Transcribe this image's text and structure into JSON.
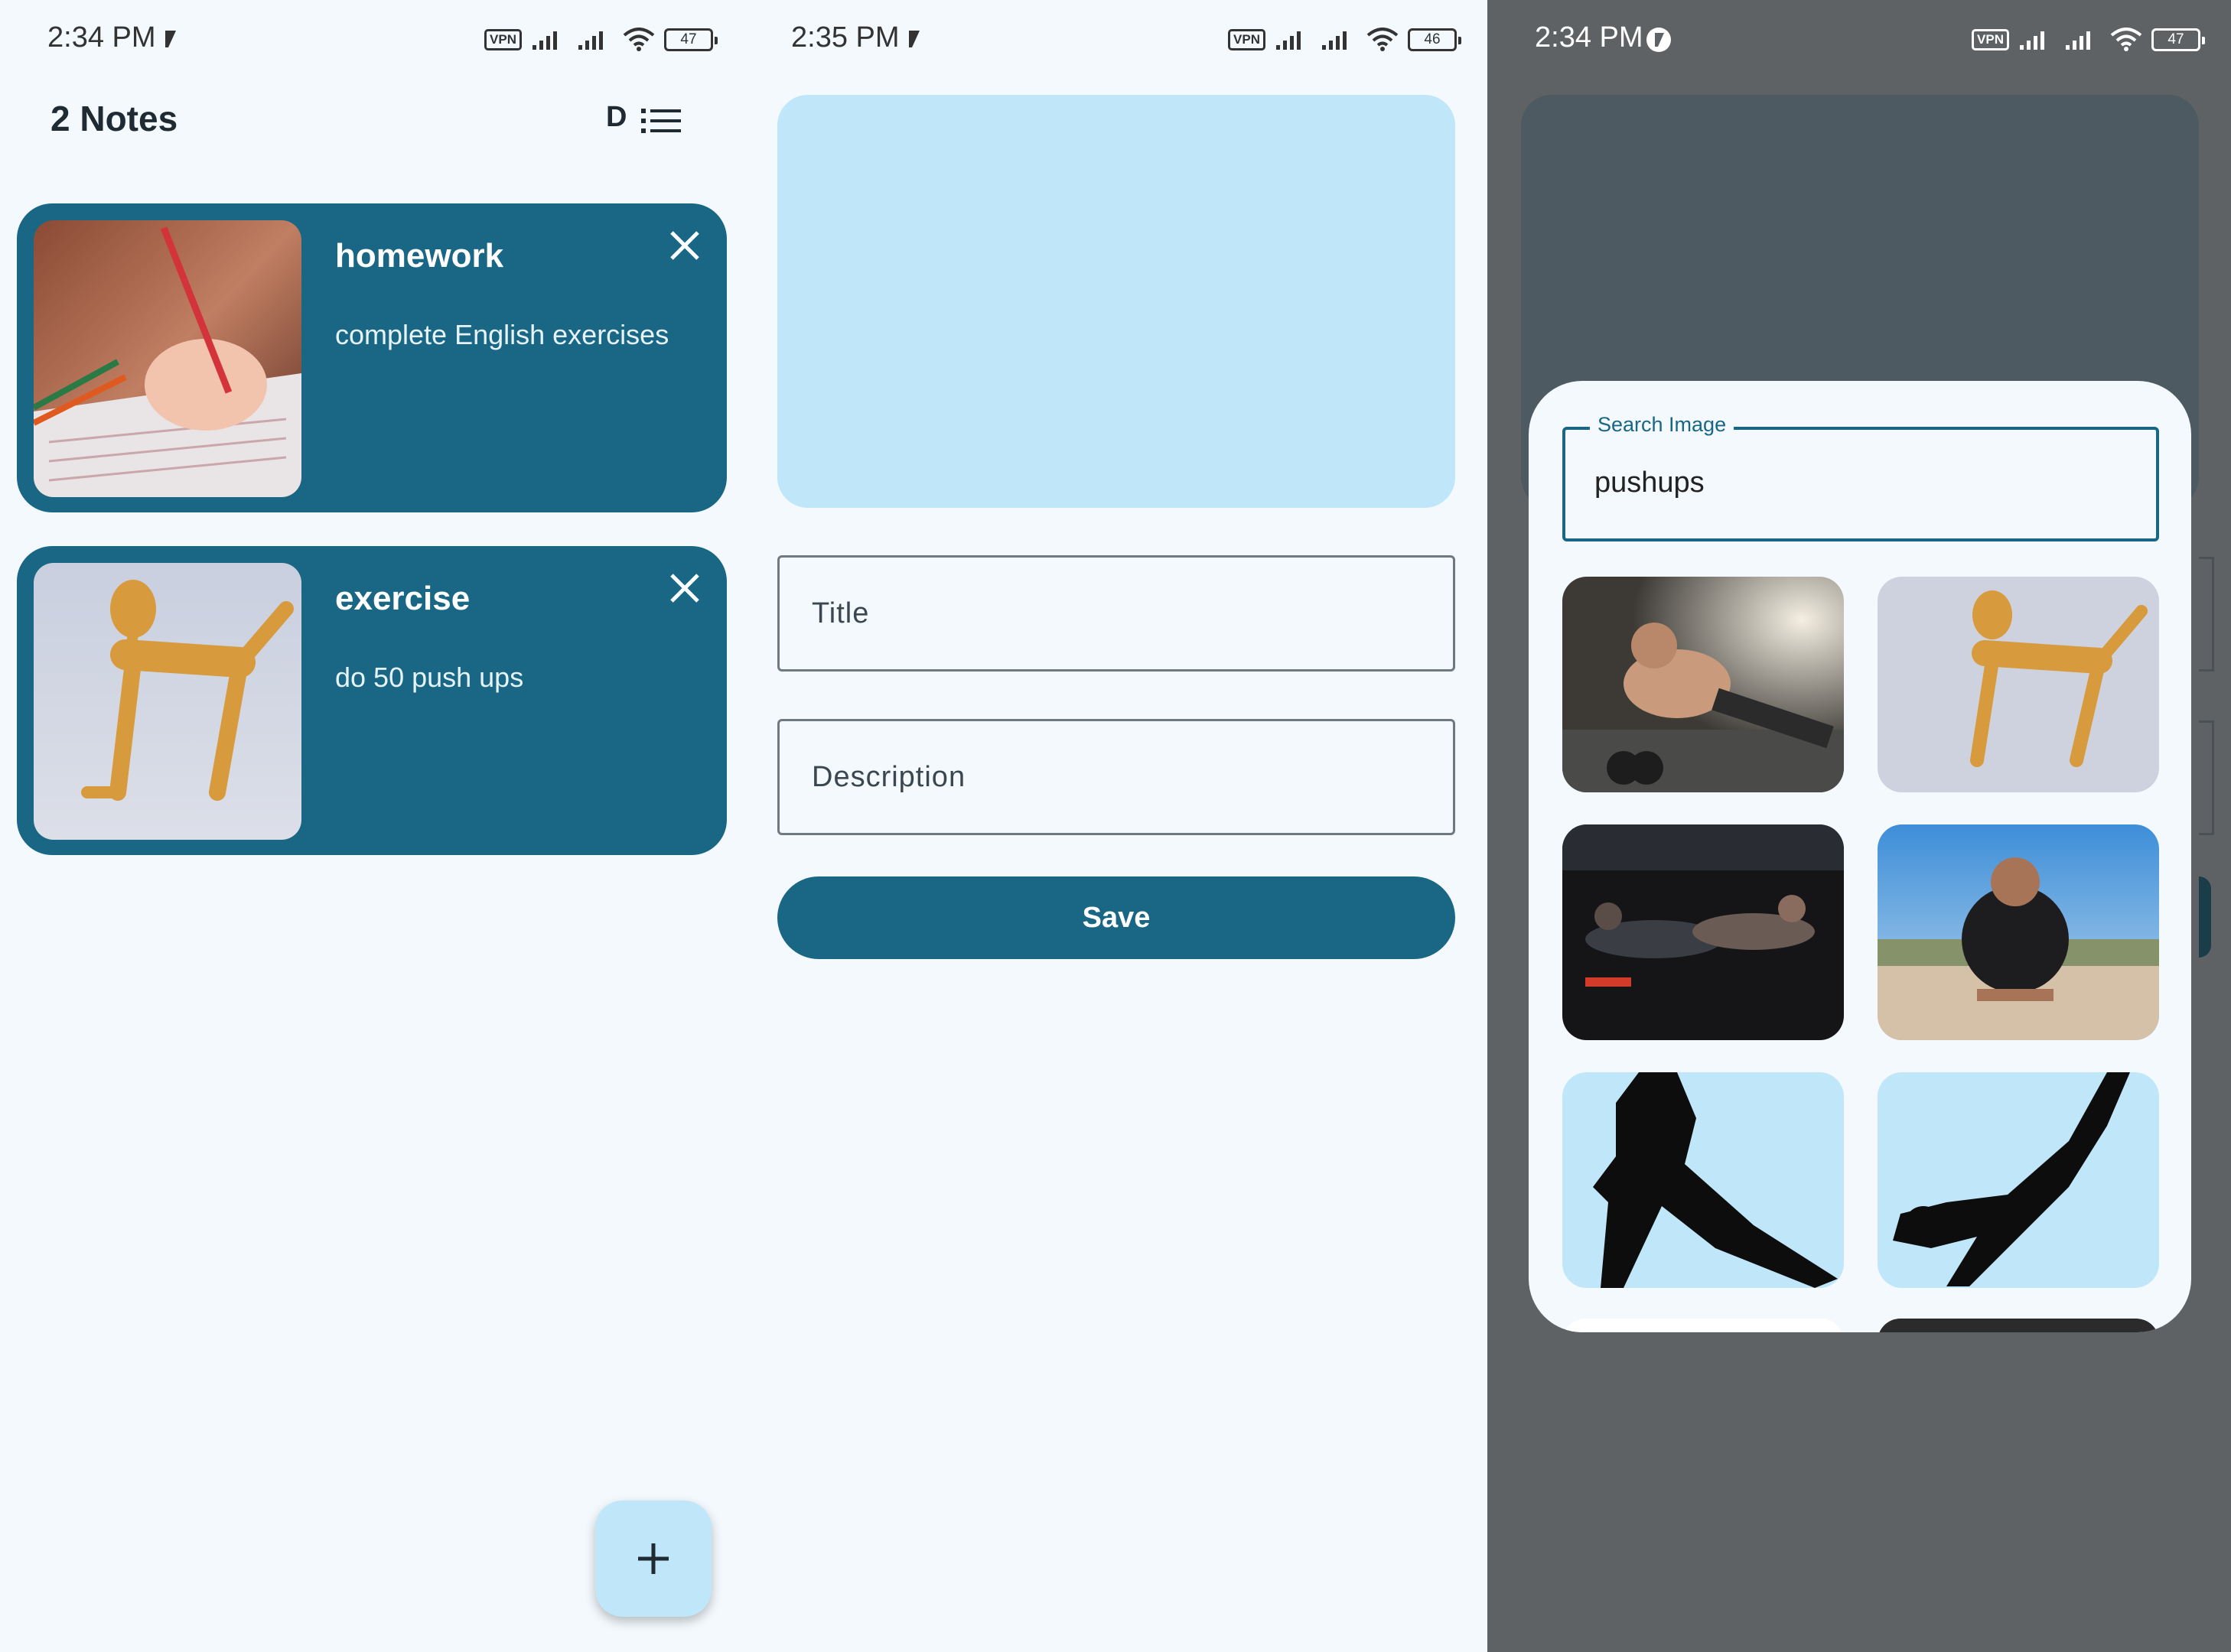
{
  "screens": {
    "notes_list": {
      "status": {
        "time": "2:34 PM",
        "battery": "47",
        "vpn": "VPN"
      },
      "title": "2 Notes",
      "sort_letter": "D",
      "notes": [
        {
          "title": "homework",
          "description": "complete English exercises"
        },
        {
          "title": "exercise",
          "description": "do 50 push ups"
        }
      ],
      "fab_icon": "plus-icon"
    },
    "add_note": {
      "status": {
        "time": "2:35 PM",
        "battery": "46",
        "vpn": "VPN"
      },
      "title_placeholder": "Title",
      "description_placeholder": "Description",
      "save_label": "Save"
    },
    "image_search": {
      "status": {
        "time": "2:34 PM",
        "battery": "47",
        "vpn": "VPN"
      },
      "search_label": "Search Image",
      "search_value": "pushups"
    }
  },
  "colors": {
    "primary": "#196784",
    "primary_container": "#c0e6fa",
    "background": "#f3f9fd",
    "scrim": "#5f6265"
  }
}
